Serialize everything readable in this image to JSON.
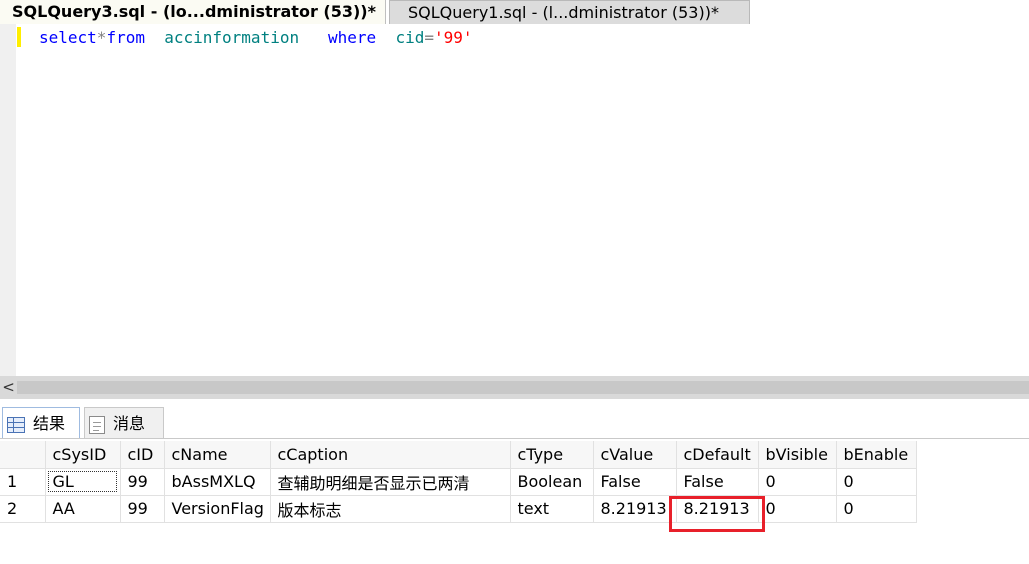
{
  "tabs": [
    {
      "label": "SQLQuery3.sql - (lo...dministrator (53))*",
      "active": true
    },
    {
      "label": "SQLQuery1.sql - (l...dministrator (53))*",
      "active": false
    }
  ],
  "editor": {
    "tokens": {
      "select": "select",
      "star": "*",
      "from": "from",
      "table": "accinformation",
      "where": "where",
      "column": "cid",
      "equals": "=",
      "value": "'99'"
    }
  },
  "scrollbar": {
    "left_arrow": "<"
  },
  "result_tabs": {
    "results": "结果",
    "messages": "消息"
  },
  "grid": {
    "columns": [
      "",
      "cSysID",
      "cID",
      "cName",
      "cCaption",
      "cType",
      "cValue",
      "cDefault",
      "bVisible",
      "bEnable"
    ],
    "rows": [
      [
        "1",
        "GL",
        "99",
        "bAssMXLQ",
        "查辅助明细是否显示已两清",
        "Boolean",
        "False",
        "False",
        "0",
        "0"
      ],
      [
        "2",
        "AA",
        "99",
        "VersionFlag",
        "版本标志",
        "text",
        "8.21913",
        "8.21913",
        "0",
        "0"
      ]
    ]
  },
  "annotation": {
    "highlight_color": "#e8202a"
  }
}
